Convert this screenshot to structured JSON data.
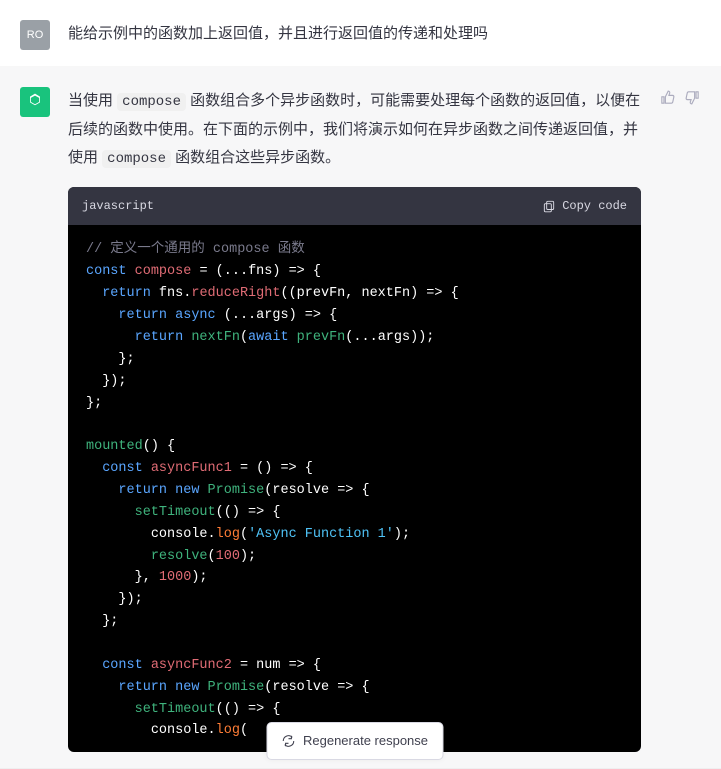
{
  "user": {
    "avatar": "RO",
    "message": "能给示例中的函数加上返回值，并且进行返回值的传递和处理吗"
  },
  "assistant": {
    "reply_prefix": "当使用 ",
    "reply_code1": "compose",
    "reply_mid": " 函数组合多个异步函数时，可能需要处理每个函数的返回值，以便在后续的函数中使用。在下面的示例中，我们将演示如何在异步函数之间传递返回值，并使用 ",
    "reply_code2": "compose",
    "reply_suffix": " 函数组合这些异步函数。",
    "code_lang": "javascript",
    "copy_label": "Copy code",
    "code": {
      "l1": "// 定义一个通用的 compose 函数",
      "kw_const": "const",
      "kw_return": "return",
      "kw_async": "async",
      "kw_await": "await",
      "kw_new": "new",
      "id_compose": "compose",
      "id_fns": "fns",
      "id_reduceRight": "reduceRight",
      "id_prevFn": "prevFn",
      "id_nextFn": "nextFn",
      "id_args": "args",
      "id_mounted": "mounted",
      "id_asyncFunc1": "asyncFunc1",
      "id_asyncFunc2": "asyncFunc2",
      "id_Promise": "Promise",
      "id_resolve": "resolve",
      "id_setTimeout": "setTimeout",
      "id_console": "console",
      "id_log": "log",
      "id_num": "num",
      "str_af1": "'Async Function 1'",
      "num_100": "100",
      "num_1000": "1000"
    }
  },
  "regen_label": "Regenerate response"
}
